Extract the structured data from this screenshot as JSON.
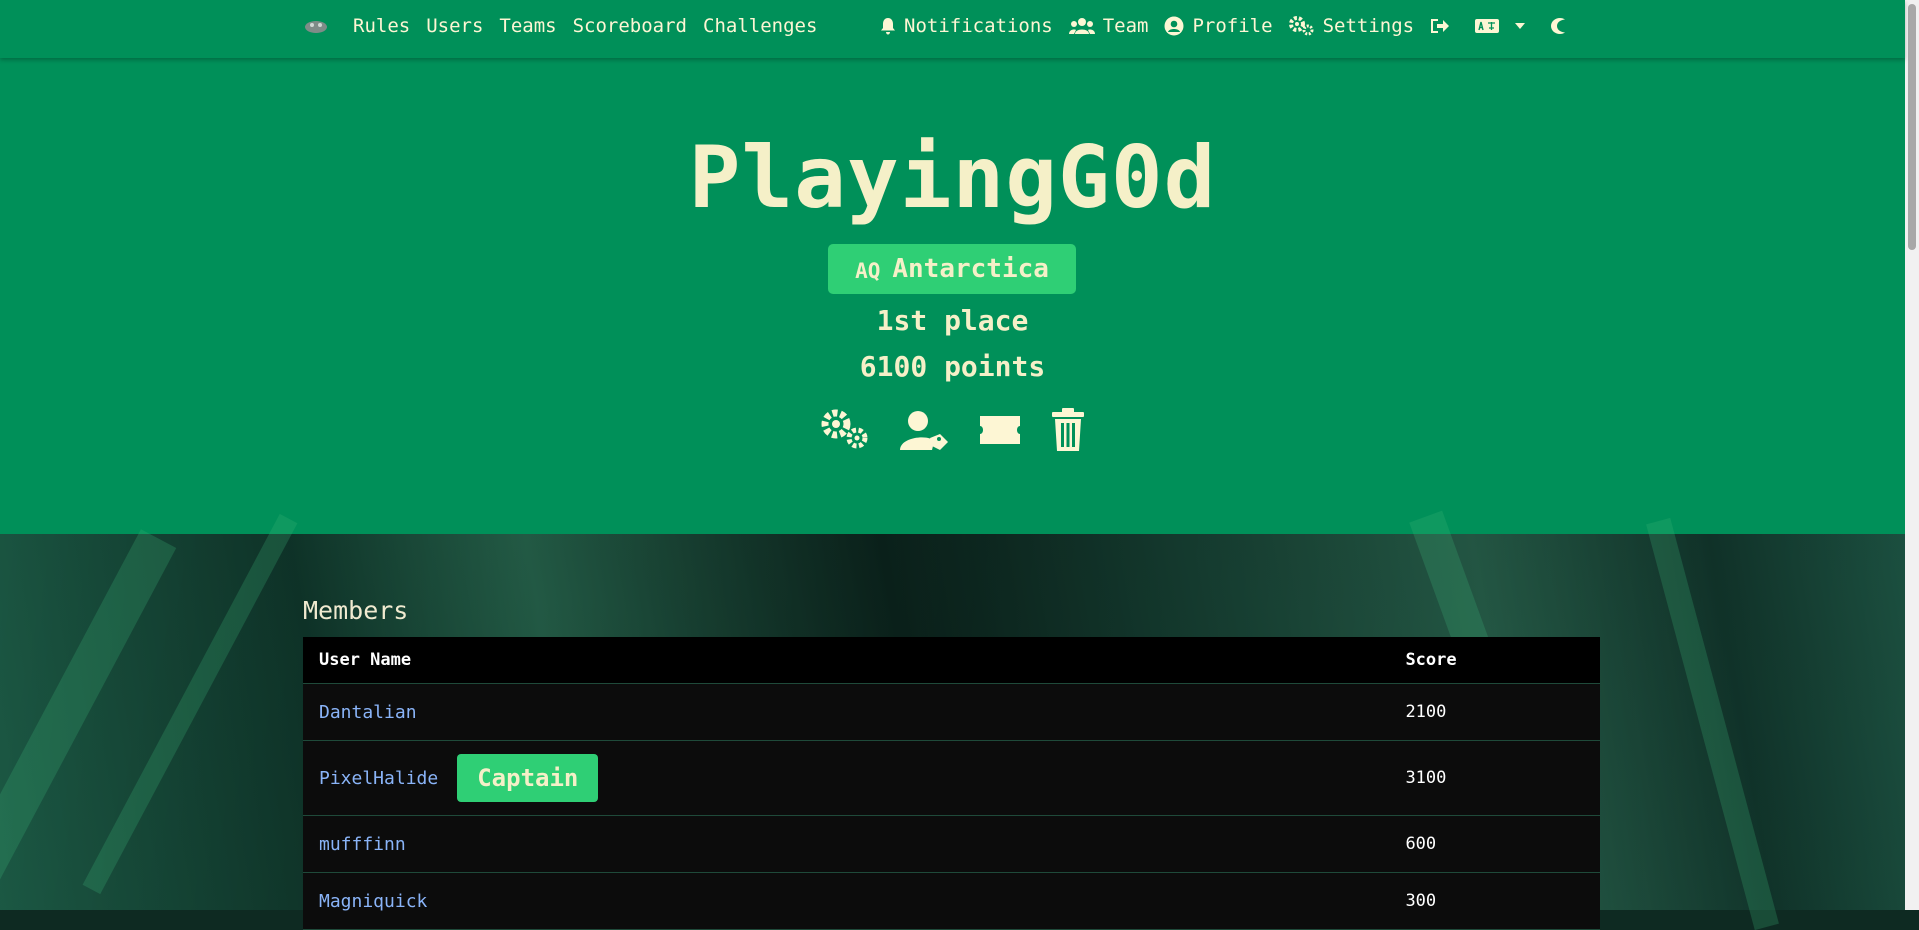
{
  "nav": {
    "left_links": [
      "Rules",
      "Users",
      "Teams",
      "Scoreboard",
      "Challenges"
    ],
    "notifications": "Notifications",
    "team": "Team",
    "profile": "Profile",
    "settings": "Settings"
  },
  "team": {
    "name": "PlayingG0d",
    "country_code": "AQ",
    "country": "Antarctica",
    "place": "1st place",
    "points": "6100 points"
  },
  "members": {
    "title": "Members",
    "col_name": "User Name",
    "col_score": "Score",
    "captain_label": "Captain",
    "rows": [
      {
        "name": "Dantalian",
        "score": "2100"
      },
      {
        "name": "PixelHalide",
        "score": "3100"
      },
      {
        "name": "mufffinn",
        "score": "600"
      },
      {
        "name": "Magniquick",
        "score": "300"
      }
    ]
  },
  "colors": {
    "primary": "#009059",
    "badge": "#2fcf75",
    "text_light": "#f5f0c8",
    "link": "#8ab4f8"
  }
}
